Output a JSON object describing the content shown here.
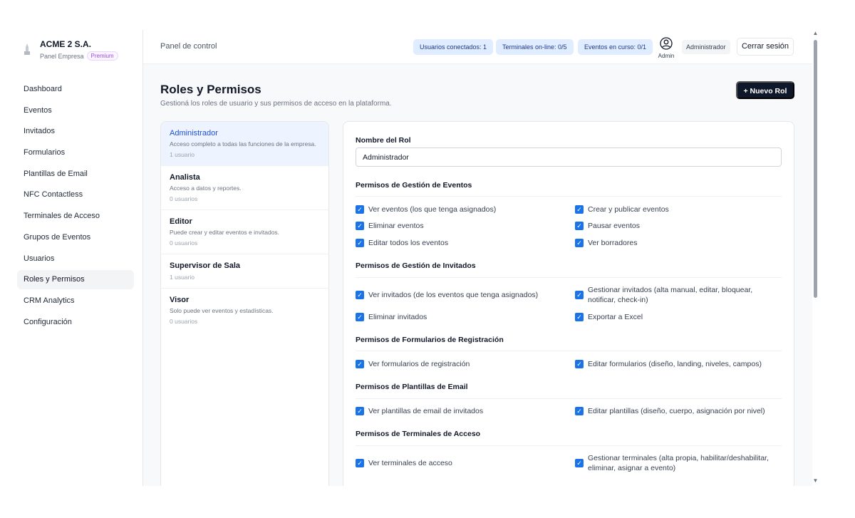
{
  "brand": {
    "name": "ACME 2 S.A.",
    "subtitle": "Panel Empresa",
    "plan_badge": "Premium",
    "logo_icon": "building-icon"
  },
  "sidebar": {
    "items": [
      {
        "label": "Dashboard",
        "active": false
      },
      {
        "label": "Eventos",
        "active": false
      },
      {
        "label": "Invitados",
        "active": false
      },
      {
        "label": "Formularios",
        "active": false
      },
      {
        "label": "Plantillas de Email",
        "active": false
      },
      {
        "label": "NFC Contactless",
        "active": false
      },
      {
        "label": "Terminales de Acceso",
        "active": false
      },
      {
        "label": "Grupos de Eventos",
        "active": false
      },
      {
        "label": "Usuarios",
        "active": false
      },
      {
        "label": "Roles y Permisos",
        "active": true
      },
      {
        "label": "CRM Analytics",
        "active": false
      },
      {
        "label": "Configuración",
        "active": false
      }
    ]
  },
  "header": {
    "title": "Panel de control",
    "stats": {
      "users": "Usuarios conectados: 1",
      "terminals": "Terminales on-line: 0/5",
      "events": "Eventos en curso: 0/1"
    },
    "user_label": "Admin",
    "role_chip": "Administrador",
    "logout_label": "Cerrar sesión"
  },
  "page": {
    "title": "Roles y Permisos",
    "subtitle": "Gestioná los roles de usuario y sus permisos de acceso en la plataforma.",
    "new_role_label": "+ Nuevo Rol"
  },
  "roles": [
    {
      "name": "Administrador",
      "desc": "Acceso completo a todas las funciones de la empresa.",
      "count": "1 usuario",
      "active": true
    },
    {
      "name": "Analista",
      "desc": "Acceso a datos y reportes.",
      "count": "0 usuarios",
      "active": false
    },
    {
      "name": "Editor",
      "desc": "Puede crear y editar eventos e invitados.",
      "count": "0 usuarios",
      "active": false
    },
    {
      "name": "Supervisor de Sala",
      "desc": "",
      "count": "1 usuario",
      "active": false
    },
    {
      "name": "Visor",
      "desc": "Solo puede ver eventos y estadísticas.",
      "count": "0 usuarios",
      "active": false
    }
  ],
  "form": {
    "role_name_label": "Nombre del Rol",
    "role_name_value": "Administrador",
    "sections": {
      "eventos": {
        "title": "Permisos de Gestión de Eventos",
        "perms": [
          "Ver eventos (los que tenga asignados)",
          "Crear y publicar eventos",
          "Eliminar eventos",
          "Pausar eventos",
          "Editar todos los eventos",
          "Ver borradores"
        ]
      },
      "invitados": {
        "title": "Permisos de Gestión de Invitados",
        "perms": [
          "Ver invitados (de los eventos que tenga asignados)",
          "Gestionar invitados (alta manual, editar, bloquear, notificar, check-in)",
          "Eliminar invitados",
          "Exportar a Excel"
        ]
      },
      "formularios": {
        "title": "Permisos de Formularios de Registración",
        "perms": [
          "Ver formularios de registración",
          "Editar formularios (diseño, landing, niveles, campos)"
        ]
      },
      "plantillas": {
        "title": "Permisos de Plantillas de Email",
        "perms": [
          "Ver plantillas de email de invitados",
          "Editar plantillas (diseño, cuerpo, asignación por nivel)"
        ]
      },
      "terminales": {
        "title": "Permisos de Terminales de Acceso",
        "perms": [
          "Ver terminales de acceso",
          "Gestionar terminales (alta propia, habilitar/deshabilitar, eliminar, asignar a evento)"
        ]
      }
    },
    "checked_glyph": "✓"
  },
  "colors": {
    "accent": "#1a73e8",
    "pill_bg": "#e0ecff",
    "primary_btn": "#0f172a"
  }
}
